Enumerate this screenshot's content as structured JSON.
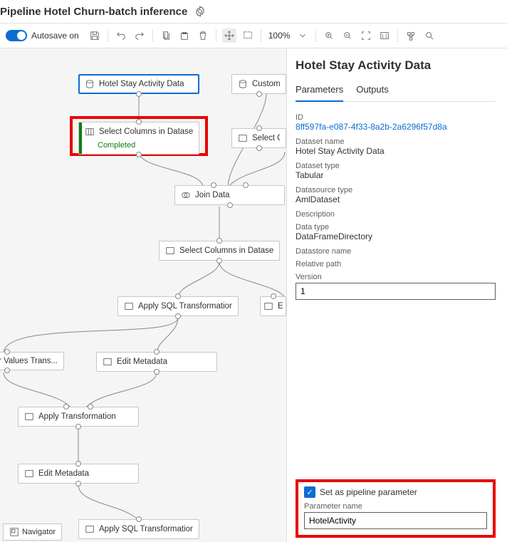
{
  "header": {
    "title": "Pipeline Hotel Churn-batch inference"
  },
  "toolbar": {
    "autosave_label": "Autosave on",
    "zoom": "100%"
  },
  "canvas": {
    "nodes": {
      "hotel_stay": "Hotel Stay Activity Data",
      "customer_dat": "Customer Dat",
      "select_cols_1": "Select Columns in Dataset",
      "select_cols_1_status": "Completed",
      "select_colum": "Select Colum",
      "join_data": "Join Data",
      "select_cols_2": "Select Columns in Dataset",
      "apply_sql_1": "Apply SQL Transformation",
      "edit_m": "Edit M",
      "tor_values": "tor Values Trans...",
      "edit_meta_1": "Edit Metadata",
      "apply_trans": "Apply Transformation",
      "edit_meta_2": "Edit Metadata",
      "apply_sql_2": "Apply SQL Transformation"
    },
    "navigator_label": "Navigator"
  },
  "panel": {
    "title": "Hotel Stay Activity Data",
    "tabs": {
      "parameters": "Parameters",
      "outputs": "Outputs"
    },
    "fields": {
      "id_label": "ID",
      "id_value": "8ff597fa-e087-4f33-8a2b-2a6296f57d8a",
      "dataset_name_label": "Dataset name",
      "dataset_name_value": "Hotel Stay Activity Data",
      "dataset_type_label": "Dataset type",
      "dataset_type_value": "Tabular",
      "datasource_type_label": "Datasource type",
      "datasource_type_value": "AmlDataset",
      "description_label": "Description",
      "data_type_label": "Data type",
      "data_type_value": "DataFrameDirectory",
      "datastore_name_label": "Datastore name",
      "relative_path_label": "Relative path",
      "version_label": "Version",
      "version_value": "1"
    },
    "param": {
      "checkbox_label": "Set as pipeline parameter",
      "name_label": "Parameter name",
      "name_value": "HotelActivity"
    }
  }
}
